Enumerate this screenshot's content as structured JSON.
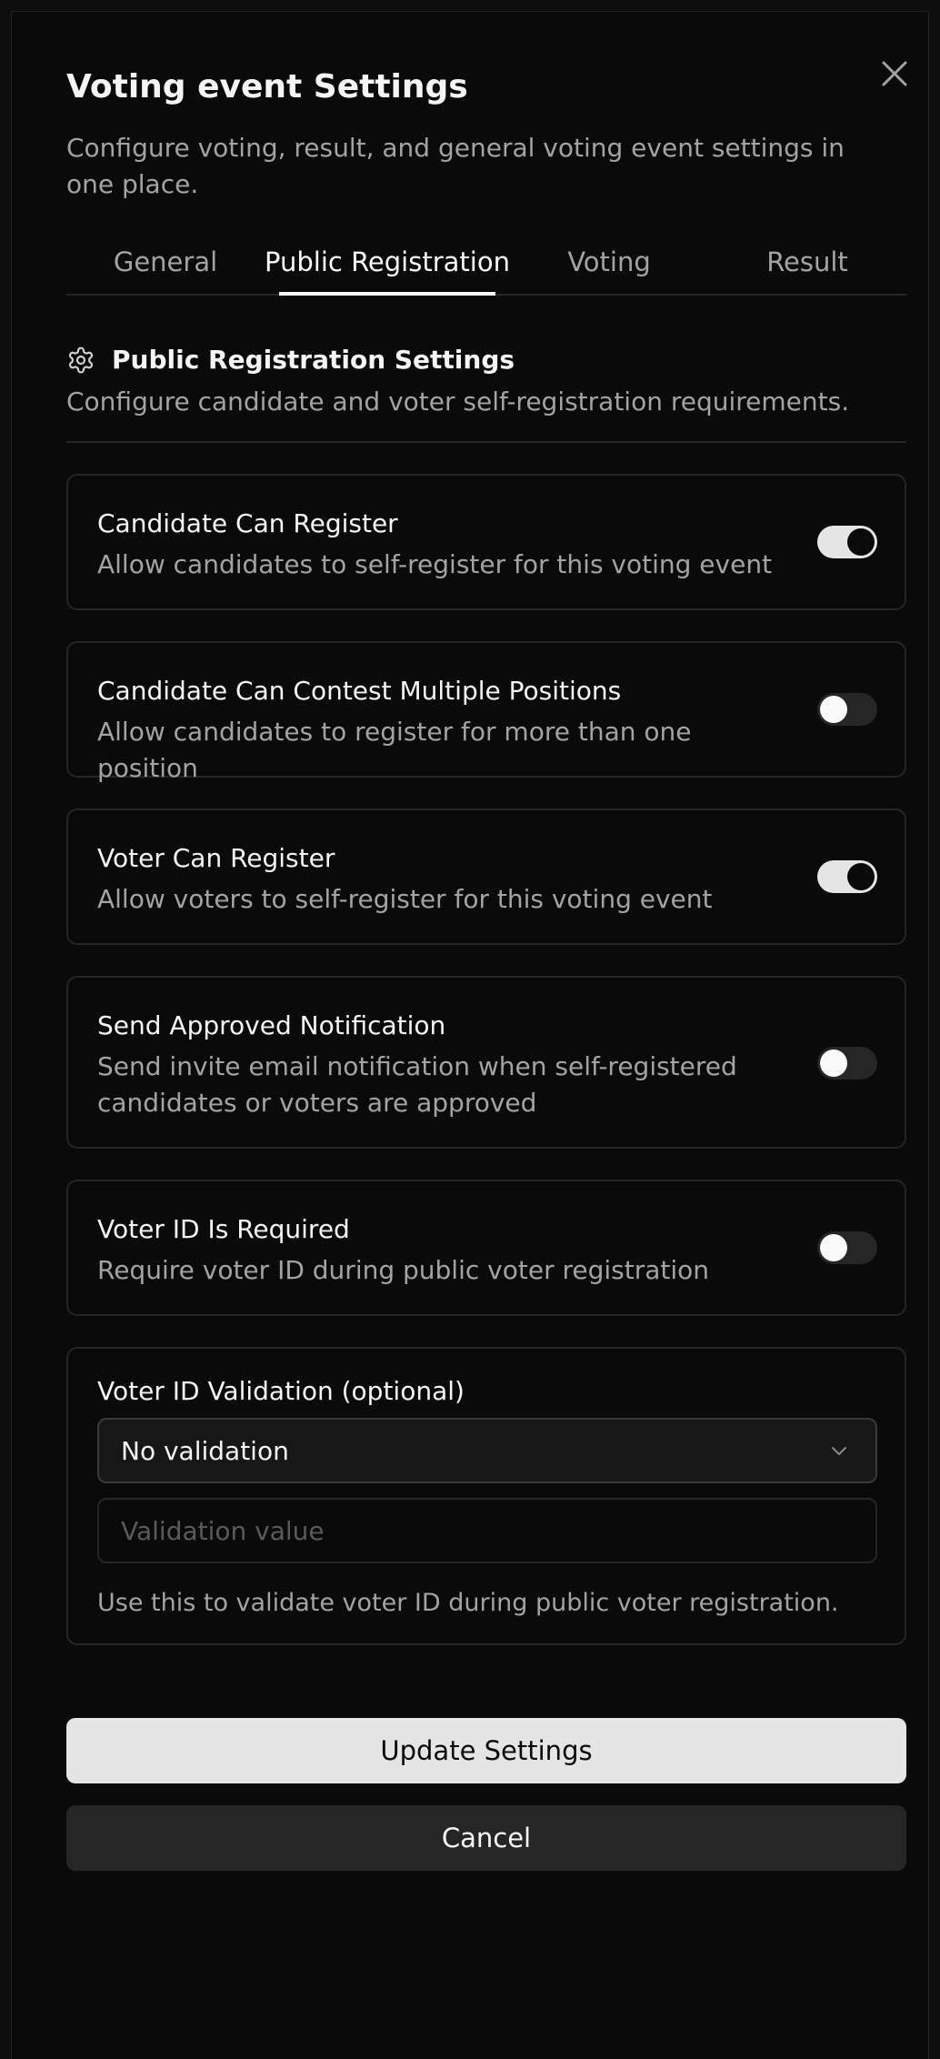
{
  "dialog": {
    "title": "Voting event Settings",
    "subtitle": "Configure voting, result, and general voting event settings in one place."
  },
  "tabs": [
    {
      "label": "General",
      "active": false
    },
    {
      "label": "Public Registration",
      "active": true
    },
    {
      "label": "Voting",
      "active": false
    },
    {
      "label": "Result",
      "active": false
    }
  ],
  "section": {
    "icon": "gear-icon",
    "title": "Public Registration Settings",
    "description": "Configure candidate and voter self-registration requirements."
  },
  "settings": [
    {
      "title": "Candidate Can Register",
      "description": "Allow candidates to self-register for this voting event",
      "enabled": true
    },
    {
      "title": "Candidate Can Contest Multiple Positions",
      "description": "Allow candidates to register for more than one position",
      "enabled": false
    },
    {
      "title": "Voter Can Register",
      "description": "Allow voters to self-register for this voting event",
      "enabled": true
    },
    {
      "title": "Send Approved Notification",
      "description": "Send invite email notification when self-registered candidates or voters are approved",
      "enabled": false
    },
    {
      "title": "Voter ID Is Required",
      "description": "Require voter ID during public voter registration",
      "enabled": false
    }
  ],
  "validation": {
    "label": "Voter ID Validation (optional)",
    "selected": "No validation",
    "placeholder": "Validation value",
    "value": "",
    "helper": "Use this to validate voter ID during public voter registration."
  },
  "actions": {
    "update_label": "Update Settings",
    "cancel_label": "Cancel"
  },
  "colors": {
    "background": "#0a0a0a",
    "border": "#262626",
    "toggle_on": "#e5e5e5",
    "primary_button": "#e5e5e5",
    "secondary_button": "#262626"
  }
}
